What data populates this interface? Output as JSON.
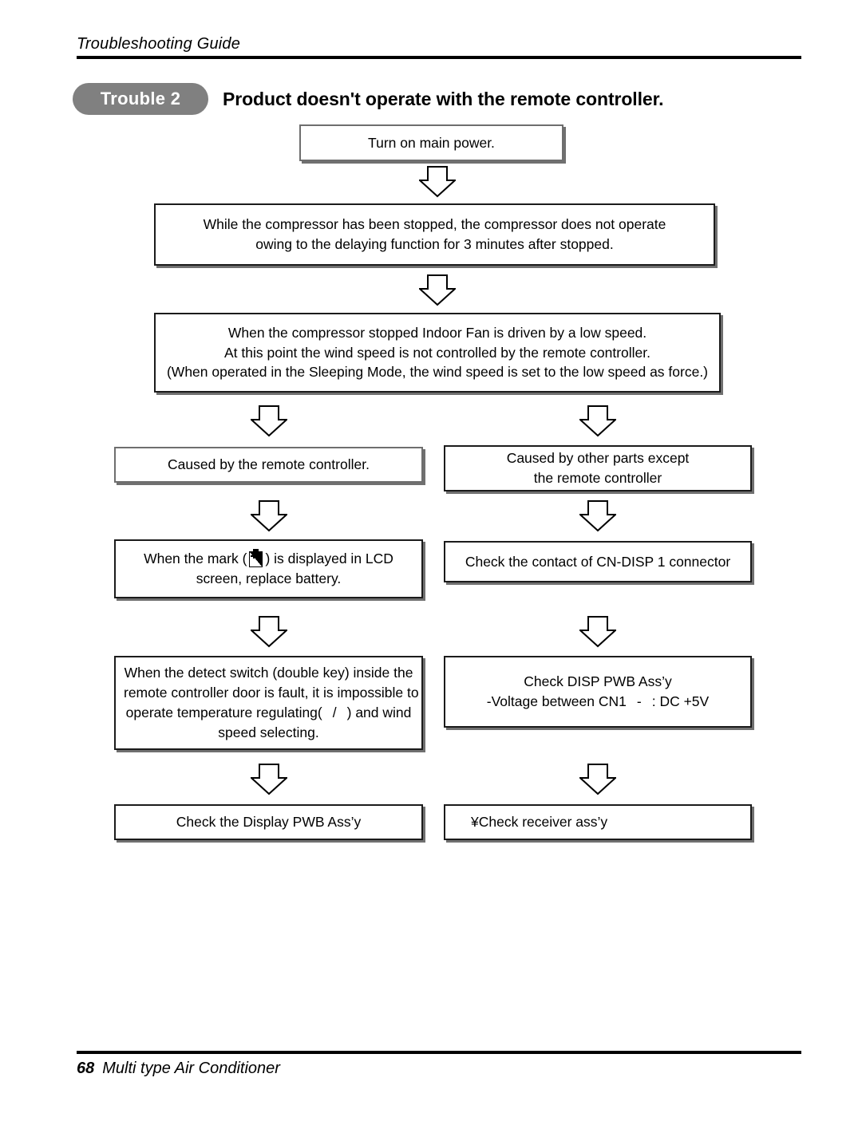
{
  "header": {
    "guide_title": "Troubleshooting Guide"
  },
  "title": {
    "badge": "Trouble 2",
    "heading": "Product doesn't operate with the remote controller."
  },
  "flow": {
    "step1": {
      "lines": [
        "Turn on main power."
      ]
    },
    "step2": {
      "lines": [
        "While the compressor has been stopped, the compressor does not operate",
        "owing to the delaying function for 3 minutes after stopped."
      ]
    },
    "step3": {
      "lines": [
        "When the compressor stopped Indoor Fan is driven by a low speed.",
        "At this point the wind speed is not controlled by the remote controller.",
        "(When operated in the Sleeping Mode, the wind speed is set to the low speed as force.)"
      ]
    },
    "left_branch": {
      "box1": {
        "lines": [
          "Caused by the remote controller."
        ]
      },
      "box2": {
        "line1_before": "When the mark (",
        "icon": "battery-low-icon",
        "line1_after": ") is displayed in LCD",
        "line2": "screen, replace battery."
      },
      "box3": {
        "line1": "When the detect switch (double key) inside the",
        "line2": "remote controller door is fault, it is impossible to",
        "line3_before": "operate temperature regulating(",
        "line3_mid": "/",
        "line3_after": ") and wind",
        "line4": "speed selecting."
      },
      "box4": {
        "lines": [
          "Check the Display PWB Ass’y"
        ]
      }
    },
    "right_branch": {
      "box1": {
        "lines": [
          "Caused by other parts except",
          "the remote controller"
        ]
      },
      "box2": {
        "lines": [
          "Check the contact of CN-DISP 1 connector"
        ]
      },
      "box3": {
        "line1": "Check DISP PWB Ass’y",
        "line2_before": "-Voltage between CN1",
        "line2_dash": "-",
        "line2_after": ": DC +5V"
      },
      "box4": {
        "lines": [
          "¥Check receiver ass’y"
        ]
      }
    }
  },
  "footer": {
    "page_number": "68",
    "product": "Multi type Air Conditioner"
  }
}
